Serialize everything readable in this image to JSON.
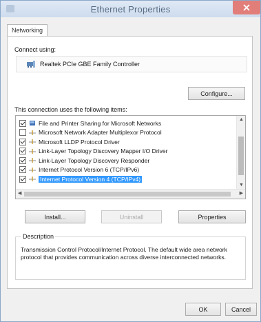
{
  "window": {
    "title": "Ethernet Properties"
  },
  "tabs": [
    {
      "label": "Networking",
      "active": true
    }
  ],
  "connect_using": {
    "label": "Connect using:",
    "adapter_name": "Realtek PCIe GBE Family Controller",
    "configure_label": "Configure..."
  },
  "items_section": {
    "label": "This connection uses the following items:",
    "items": [
      {
        "label": "File and Printer Sharing for Microsoft Networks",
        "checked": true,
        "icon": "network-share-icon"
      },
      {
        "label": "Microsoft Network Adapter Multiplexor Protocol",
        "checked": false,
        "icon": "protocol-icon"
      },
      {
        "label": "Microsoft LLDP Protocol Driver",
        "checked": true,
        "icon": "protocol-icon"
      },
      {
        "label": "Link-Layer Topology Discovery Mapper I/O Driver",
        "checked": true,
        "icon": "protocol-icon"
      },
      {
        "label": "Link-Layer Topology Discovery Responder",
        "checked": true,
        "icon": "protocol-icon"
      },
      {
        "label": "Internet Protocol Version 6 (TCP/IPv6)",
        "checked": true,
        "icon": "protocol-icon"
      },
      {
        "label": "Internet Protocol Version 4 (TCP/IPv4)",
        "checked": true,
        "icon": "protocol-icon",
        "selected": true
      }
    ]
  },
  "buttons": {
    "install": "Install...",
    "uninstall": "Uninstall",
    "properties": "Properties",
    "ok": "OK",
    "cancel": "Cancel"
  },
  "description": {
    "label": "Description",
    "text": "Transmission Control Protocol/Internet Protocol. The default wide area network protocol that provides communication across diverse interconnected networks."
  },
  "colors": {
    "selection": "#3399ff",
    "close_button": "#e27e7a"
  }
}
